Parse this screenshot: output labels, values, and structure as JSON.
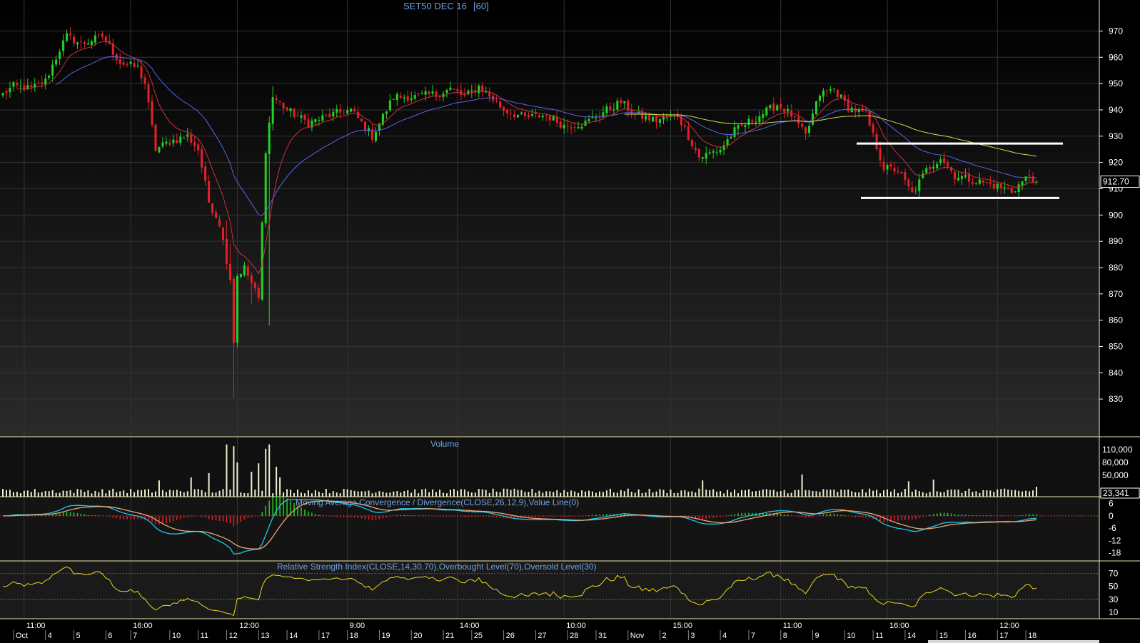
{
  "colors": {
    "up": "#22d022",
    "down": "#e0202a",
    "ema_fast": "#c8323c",
    "ema_mid": "#5a64e6",
    "ema_slow": "#d8d84c",
    "volume": "#f0f0d0",
    "macd": "#20c8e8",
    "signal": "#e8a878",
    "rsi": "#e8d820",
    "title": "#6fa3e0",
    "grid": "#333333"
  },
  "chart_data": [
    {
      "type": "candlestick",
      "title": "SET50 DEC 16",
      "interval": "[60]",
      "last_price_label": "912.70",
      "last_price": 912.7,
      "y_ticks": [
        830,
        840,
        850,
        860,
        870,
        880,
        890,
        900,
        910,
        920,
        930,
        940,
        950,
        960,
        970
      ],
      "ylim": [
        820,
        978
      ],
      "support_line": 906.5,
      "resistance_line": 927.2,
      "anchors": [
        [
          0,
          946
        ],
        [
          3,
          949
        ],
        [
          8,
          948
        ],
        [
          12,
          951
        ],
        [
          16,
          963
        ],
        [
          18,
          968
        ],
        [
          22,
          965
        ],
        [
          28,
          968
        ],
        [
          33,
          958
        ],
        [
          38,
          956
        ],
        [
          40,
          950
        ],
        [
          43,
          925
        ],
        [
          47,
          928
        ],
        [
          52,
          930
        ],
        [
          55,
          925
        ],
        [
          58,
          905
        ],
        [
          61,
          897
        ],
        [
          64,
          876
        ],
        [
          65,
          852
        ],
        [
          66,
          877
        ],
        [
          68,
          880
        ],
        [
          70,
          874
        ],
        [
          72,
          868
        ],
        [
          74,
          925
        ],
        [
          76,
          945
        ],
        [
          80,
          940
        ],
        [
          86,
          935
        ],
        [
          92,
          938
        ],
        [
          98,
          940
        ],
        [
          104,
          930
        ],
        [
          110,
          945
        ],
        [
          116,
          945
        ],
        [
          122,
          946
        ],
        [
          126,
          948
        ],
        [
          130,
          945
        ],
        [
          134,
          949
        ],
        [
          138,
          944
        ],
        [
          141,
          940
        ],
        [
          147,
          937
        ],
        [
          153,
          938
        ],
        [
          158,
          934
        ],
        [
          164,
          935
        ],
        [
          170,
          940
        ],
        [
          174,
          943
        ],
        [
          178,
          938
        ],
        [
          184,
          936
        ],
        [
          190,
          938
        ],
        [
          196,
          922
        ],
        [
          202,
          925
        ],
        [
          206,
          932
        ],
        [
          212,
          937
        ],
        [
          218,
          942
        ],
        [
          222,
          938
        ],
        [
          226,
          930
        ],
        [
          230,
          946
        ],
        [
          234,
          948
        ],
        [
          238,
          941
        ],
        [
          243,
          938
        ],
        [
          248,
          918
        ],
        [
          252,
          917
        ],
        [
          256,
          908
        ],
        [
          260,
          917
        ],
        [
          264,
          922
        ],
        [
          268,
          915
        ],
        [
          274,
          913
        ],
        [
          280,
          911
        ],
        [
          284,
          909
        ],
        [
          289,
          915
        ],
        [
          291,
          912.7
        ]
      ],
      "bar_count": 292
    },
    {
      "type": "bar",
      "title": "Volume",
      "y_ticks": [
        "110,000",
        "80,000",
        "50,000"
      ],
      "last_value_label": "23,341",
      "ylim": [
        0,
        130000
      ],
      "spikes": [
        [
          44,
          38000
        ],
        [
          53,
          45000
        ],
        [
          58,
          55000
        ],
        [
          63,
          122000
        ],
        [
          65,
          118000
        ],
        [
          66,
          80000
        ],
        [
          70,
          58000
        ],
        [
          72,
          78000
        ],
        [
          74,
          112000
        ],
        [
          75,
          122000
        ],
        [
          77,
          70000
        ],
        [
          78,
          45000
        ],
        [
          197,
          38000
        ],
        [
          225,
          52000
        ],
        [
          255,
          36000
        ],
        [
          262,
          40000
        ]
      ],
      "base": 14000
    },
    {
      "type": "line",
      "title": "Moving Average Convergence / Divergence(CLOSE,26,12,9),Value Line(0)",
      "y_ticks": [
        "6",
        "0",
        "-6",
        "-12",
        "-18"
      ],
      "ylim": [
        -22,
        8
      ]
    },
    {
      "type": "line",
      "title": "Relative Strength Index(CLOSE,14,30,70),Overbought Level(70),Oversold Level(30)",
      "y_ticks": [
        "70",
        "50",
        "30",
        "10"
      ],
      "ylim": [
        0,
        85
      ],
      "overbought": 70,
      "oversold": 30
    }
  ],
  "x_time_labels": [
    {
      "bar": 6,
      "label": "11:00"
    },
    {
      "bar": 36,
      "label": "16:00"
    },
    {
      "bar": 66,
      "label": "12:00"
    },
    {
      "bar": 97,
      "label": "9:00"
    },
    {
      "bar": 128,
      "label": "14:00"
    },
    {
      "bar": 158,
      "label": "10:00"
    },
    {
      "bar": 188,
      "label": "15:00"
    },
    {
      "bar": 219,
      "label": "11:00"
    },
    {
      "bar": 249,
      "label": "16:00"
    },
    {
      "bar": 280,
      "label": "12:00"
    }
  ],
  "x_date_labels": [
    {
      "bar": 3,
      "label": "Oct"
    },
    {
      "bar": 12,
      "label": "4"
    },
    {
      "bar": 20,
      "label": "5"
    },
    {
      "bar": 29,
      "label": "6"
    },
    {
      "bar": 36,
      "label": "7"
    },
    {
      "bar": 47,
      "label": "10"
    },
    {
      "bar": 55,
      "label": "11"
    },
    {
      "bar": 63,
      "label": "12"
    },
    {
      "bar": 72,
      "label": "13"
    },
    {
      "bar": 80,
      "label": "14"
    },
    {
      "bar": 89,
      "label": "17"
    },
    {
      "bar": 97,
      "label": "18"
    },
    {
      "bar": 106,
      "label": "19"
    },
    {
      "bar": 115,
      "label": "20"
    },
    {
      "bar": 124,
      "label": "21"
    },
    {
      "bar": 132,
      "label": "25"
    },
    {
      "bar": 141,
      "label": "26"
    },
    {
      "bar": 150,
      "label": "27"
    },
    {
      "bar": 159,
      "label": "28"
    },
    {
      "bar": 167,
      "label": "31"
    },
    {
      "bar": 176,
      "label": "Nov"
    },
    {
      "bar": 185,
      "label": "2"
    },
    {
      "bar": 193,
      "label": "3"
    },
    {
      "bar": 202,
      "label": "4"
    },
    {
      "bar": 210,
      "label": "7"
    },
    {
      "bar": 219,
      "label": "8"
    },
    {
      "bar": 228,
      "label": "9"
    },
    {
      "bar": 237,
      "label": "10"
    },
    {
      "bar": 245,
      "label": "11"
    },
    {
      "bar": 254,
      "label": "14"
    },
    {
      "bar": 263,
      "label": "15"
    },
    {
      "bar": 271,
      "label": "16"
    },
    {
      "bar": 280,
      "label": "17"
    },
    {
      "bar": 288,
      "label": "18"
    }
  ]
}
